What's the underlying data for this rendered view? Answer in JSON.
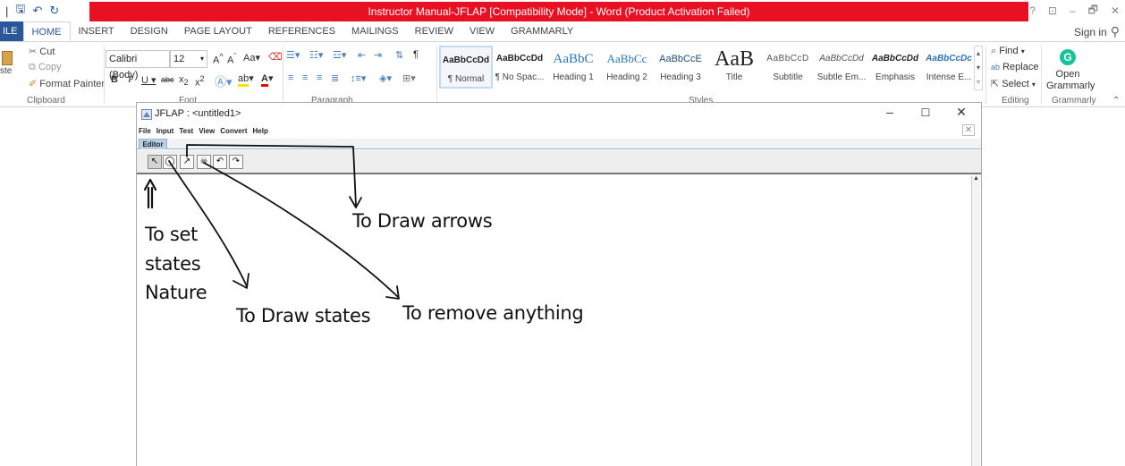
{
  "word": {
    "title": "Instructor Manual-JFLAP [Compatibility Mode] - Word (Product Activation Failed)",
    "window_controls": [
      "?",
      "⊡",
      "–",
      "🗗",
      "✕"
    ],
    "tabs": {
      "file": "ILE",
      "items": [
        "HOME",
        "INSERT",
        "DESIGN",
        "PAGE LAYOUT",
        "REFERENCES",
        "MAILINGS",
        "REVIEW",
        "VIEW",
        "GRAMMARLY"
      ],
      "active": "HOME"
    },
    "sign_in": "Sign in",
    "clipboard": {
      "paste": "ste",
      "cut": "Cut",
      "copy": "Copy",
      "format_painter": "Format Painter",
      "label": "Clipboard"
    },
    "font": {
      "name": "Calibri (Body)",
      "size": "12",
      "label": "Font"
    },
    "paragraph_label": "Paragraph",
    "styles": {
      "label": "Styles",
      "items": [
        {
          "sample": "AaBbCcDd",
          "name": "¶ Normal",
          "selected": true
        },
        {
          "sample": "AaBbCcDd",
          "name": "¶ No Spac..."
        },
        {
          "sample": "AaBbC",
          "name": "Heading 1"
        },
        {
          "sample": "AaBbCc",
          "name": "Heading 2"
        },
        {
          "sample": "AaBbCcE",
          "name": "Heading 3"
        },
        {
          "sample": "AaB",
          "name": "Title"
        },
        {
          "sample": "AaBbCcD",
          "name": "Subtitle"
        },
        {
          "sample": "AaBbCcDd",
          "name": "Subtle Em..."
        },
        {
          "sample": "AaBbCcDd",
          "name": "Emphasis"
        },
        {
          "sample": "AaBbCcDc",
          "name": "Intense E..."
        }
      ]
    },
    "editing": {
      "find": "Find",
      "replace": "Replace",
      "select": "Select",
      "label": "Editing"
    },
    "grammarly": {
      "button_line1": "Open",
      "button_line2": "Grammarly",
      "label": "Grammarly",
      "logo": "G"
    }
  },
  "jflap": {
    "title": "JFLAP : <untitled1>",
    "menu": [
      "File",
      "Input",
      "Test",
      "View",
      "Convert",
      "Help"
    ],
    "tab": "Editor",
    "tools": [
      {
        "name": "attribute-editor",
        "glyph": "↖"
      },
      {
        "name": "state-creator",
        "glyph": "◯"
      },
      {
        "name": "transition-creator",
        "glyph": "↗"
      },
      {
        "name": "deleter",
        "glyph": "☠"
      },
      {
        "name": "undo",
        "glyph": "↶"
      },
      {
        "name": "redo",
        "glyph": "↷"
      }
    ]
  },
  "annotations": {
    "draw_arrows": "To Draw arrows",
    "set_states_line1": "To set",
    "set_states_line2": "states",
    "set_states_line3": "Nature",
    "draw_states": "To Draw states",
    "remove_anything": "To remove anything"
  },
  "colors": {
    "title_red": "#e81123",
    "word_blue": "#2b579a",
    "jflap_tab": "#b8cfe5",
    "grammarly_green": "#15c39a"
  }
}
